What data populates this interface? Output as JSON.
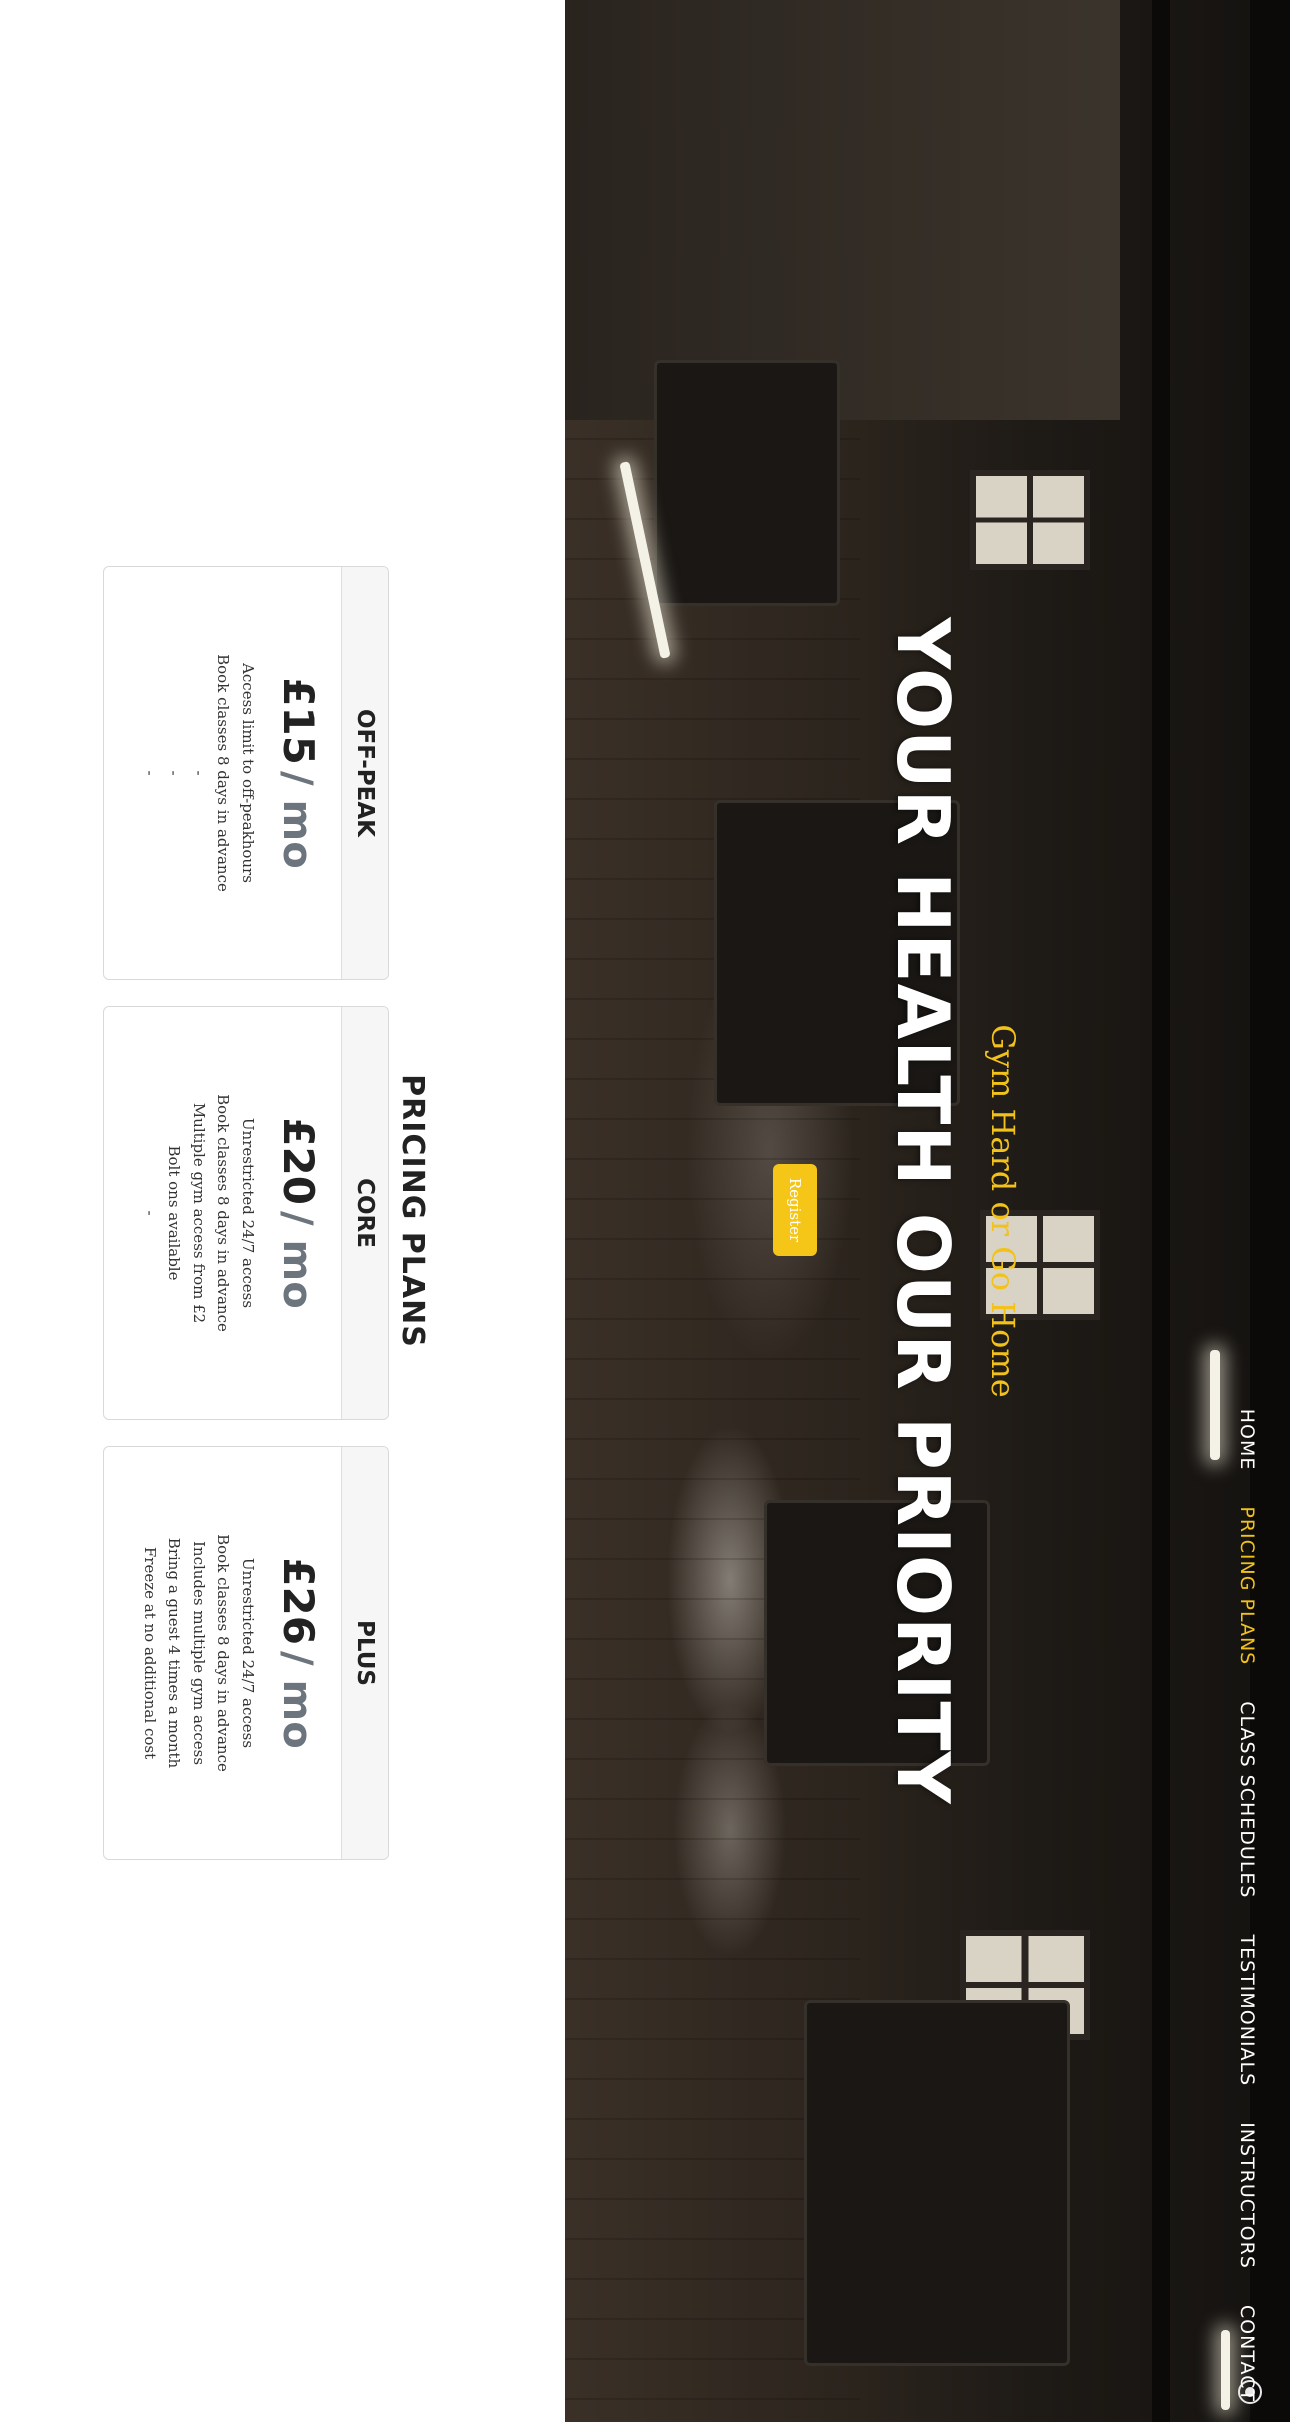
{
  "nav": {
    "items": [
      {
        "label": "HOME",
        "active": false
      },
      {
        "label": "PRICING PLANS",
        "active": true
      },
      {
        "label": "CLASS SCHEDULES",
        "active": false
      },
      {
        "label": "TESTIMONIALS",
        "active": false
      },
      {
        "label": "INSTRUCTORS",
        "active": false
      },
      {
        "label": "CONTACT",
        "active": false
      }
    ]
  },
  "hero": {
    "title": "YOUR HEALTH OUR PRIORITY",
    "tagline": "Gym Hard or Go Home",
    "register_label": "Register"
  },
  "pricing": {
    "title": "PRICING PLANS",
    "plans": [
      {
        "name": "OFF-PEAK",
        "price": "£15",
        "unit": "/ mo",
        "features": [
          "Access limit to off-peakhours",
          "Book classes 8 days in advance",
          "-",
          "-",
          "-"
        ]
      },
      {
        "name": "CORE",
        "price": "£20",
        "unit": "/ mo",
        "features": [
          "Unrestricted 24/7 access",
          "Book classes 8 days in advance",
          "Multiple gym access from £2",
          "Bolt ons available",
          "-"
        ]
      },
      {
        "name": "PLUS",
        "price": "£26",
        "unit": "/ mo",
        "features": [
          "Unrestricted 24/7 access",
          "Book classes 8 days in advance",
          "Includes multiple gym access",
          "Bring a guest 4 times a month",
          "Freeze at no additional cost"
        ]
      }
    ]
  },
  "colors": {
    "accent": "#f2c21b",
    "button": "#f5c518",
    "price_unit": "#6c757d",
    "card_header": "#f6f6f6"
  }
}
